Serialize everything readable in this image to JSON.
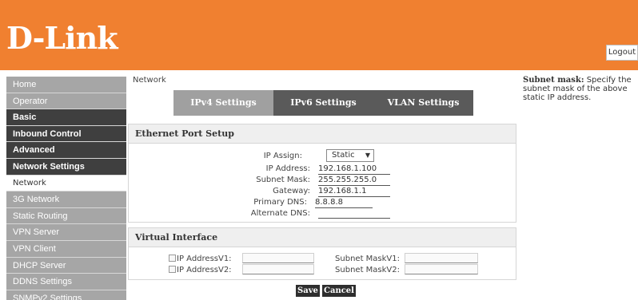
{
  "header": {
    "logo_text": "D-Link",
    "logout_label": "Logout",
    "brand_color": "#f08030"
  },
  "sidebar": {
    "items": [
      {
        "label": "Home",
        "style": "light"
      },
      {
        "label": "Operator",
        "style": "light"
      },
      {
        "label": "Basic",
        "style": "dark"
      },
      {
        "label": "Inbound Control",
        "style": "dark"
      },
      {
        "label": "Advanced",
        "style": "dark"
      },
      {
        "label": "Network Settings",
        "style": "dark"
      },
      {
        "label": "Network",
        "style": "active"
      },
      {
        "label": "3G Network",
        "style": "light"
      },
      {
        "label": "Static Routing",
        "style": "light"
      },
      {
        "label": "VPN Server",
        "style": "light"
      },
      {
        "label": "VPN Client",
        "style": "light"
      },
      {
        "label": "DHCP Server",
        "style": "light"
      },
      {
        "label": "DDNS Settings",
        "style": "light"
      },
      {
        "label": "SNMPv2 Settings",
        "style": "light"
      }
    ]
  },
  "main": {
    "breadcrumb": "Network",
    "tabs": [
      {
        "label": "IPv4 Settings",
        "active": true
      },
      {
        "label": "IPv6 Settings",
        "active": false
      },
      {
        "label": "VLAN Settings",
        "active": false
      }
    ],
    "ethernet": {
      "title": "Ethernet Port Setup",
      "ip_assign_label": "IP Assign:",
      "ip_assign_value": "Static",
      "ip_address_label": "IP Address:",
      "ip_address_value": "192.168.1.100",
      "subnet_mask_label": "Subnet Mask:",
      "subnet_mask_value": "255.255.255.0",
      "gateway_label": "Gateway:",
      "gateway_value": "192.168.1.1",
      "primary_dns_label": "Primary DNS:",
      "primary_dns_value": "8.8.8.8",
      "alternate_dns_label": "Alternate DNS:",
      "alternate_dns_value": ""
    },
    "virtual_interface": {
      "title": "Virtual Interface",
      "ip_v1_label": "IP AddressV1:",
      "ip_v2_label": "IP AddressV2:",
      "mask_v1_label": "Subnet MaskV1:",
      "mask_v2_label": "Subnet MaskV2:"
    },
    "save_label": "Save",
    "cancel_label": "Cancel"
  },
  "help": {
    "term": "Subnet mask:",
    "text": " Specify the subnet mask of the above static IP address."
  }
}
